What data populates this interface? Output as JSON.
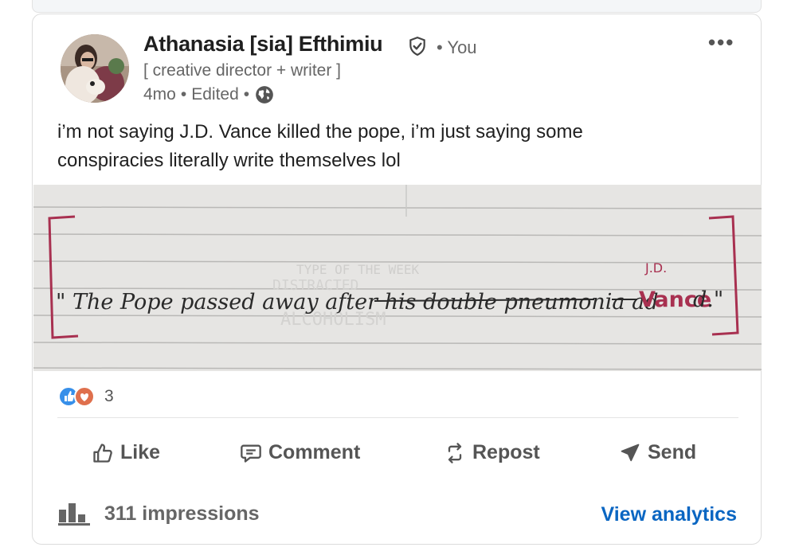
{
  "post": {
    "author": {
      "name": "Athanasia [sia] Efthimiu",
      "relation": "• You",
      "headline": "[ creative director + writer ]",
      "time": "4mo",
      "edited": "Edited"
    },
    "text": "i’m not saying J.D. Vance killed the pope, i’m just saying some conspiracies literally write themselves lol",
    "image": {
      "handwriting": "\" The Pope passed away after his double pneumonia ad",
      "handwriting_vanced": "Vance",
      "handwriting_end": "d.\"",
      "insert_note": "J.D.",
      "faint_heading": "TYPE OF THE WEEK",
      "faint_lines": [
        "DISTRACTED",
        "ALCOHOLISM"
      ]
    },
    "reactions": {
      "count": "3",
      "types": [
        "like-icon",
        "love-icon"
      ]
    },
    "actions": [
      {
        "label": "Like",
        "icon": "thumbs-up-icon"
      },
      {
        "label": "Comment",
        "icon": "comment-icon"
      },
      {
        "label": "Repost",
        "icon": "repost-icon"
      },
      {
        "label": "Send",
        "icon": "send-icon"
      }
    ],
    "footer": {
      "impressions": "311 impressions",
      "analytics": "View analytics"
    }
  },
  "colors": {
    "link": "#0a66c2",
    "muted": "#666666",
    "like_blue": "#378fe9",
    "love_red": "#df704d",
    "ink_pink": "#b03a5b"
  }
}
